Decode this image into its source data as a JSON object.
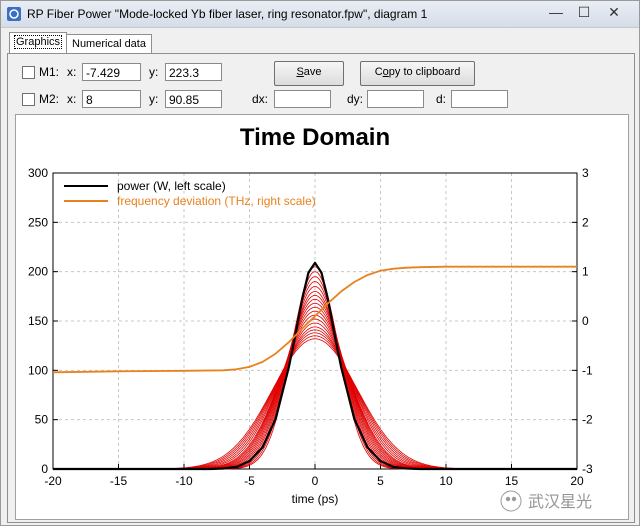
{
  "window": {
    "title": "RP Fiber Power \"Mode-locked Yb fiber laser, ring resonator.fpw\", diagram 1",
    "minimize_glyph": "—",
    "maximize_glyph": "☐",
    "close_glyph": "✕"
  },
  "tabs": [
    {
      "label": "Graphics",
      "active": true
    },
    {
      "label": "Numerical data",
      "active": false
    }
  ],
  "markers": {
    "m1": {
      "label": "M1:",
      "x_label": "x:",
      "x": "-7.429",
      "y_label": "y:",
      "y": "223.3",
      "checked": false
    },
    "m2": {
      "label": "M2:",
      "x_label": "x:",
      "x": "8",
      "y_label": "y:",
      "y": "90.85",
      "checked": false
    },
    "dx_label": "dx:",
    "dx": "",
    "dy_label": "dy:",
    "dy": "",
    "d_label": "d:",
    "d": ""
  },
  "buttons": {
    "save_hot": "S",
    "save_rest": "ave",
    "copy_pre": "C",
    "copy_hot": "o",
    "copy_rest": "py to clipboard"
  },
  "watermark": "武汉星光",
  "colors": {
    "power": "#000000",
    "power_history": "#e00000",
    "frequency": "#e8821e",
    "grid": "#c8c8c8"
  },
  "chart_data": {
    "type": "line",
    "title": "Time Domain",
    "xlabel": "time (ps)",
    "ylabel": "",
    "xlim": [
      -20,
      20
    ],
    "ylim": [
      0,
      300
    ],
    "y2lim": [
      -3,
      3
    ],
    "x_ticks": [
      -20,
      -15,
      -10,
      -5,
      0,
      5,
      10,
      15,
      20
    ],
    "x_tick_labels": [
      "-20",
      "-15",
      "-10",
      "-5",
      "0",
      "5",
      "10",
      "15",
      "20"
    ],
    "y_ticks": [
      0,
      50,
      100,
      150,
      200,
      250,
      300
    ],
    "y_tick_labels": [
      "0",
      "50",
      "100",
      "150",
      "200",
      "250",
      "300"
    ],
    "y2_ticks": [
      -3,
      -2,
      -1,
      0,
      1,
      2,
      3
    ],
    "y2_tick_labels": [
      "-3",
      "-2",
      "-1",
      "0",
      "1",
      "2",
      "3"
    ],
    "grid": true,
    "legend_position": "top-left",
    "series": [
      {
        "name": "power (W, left scale)",
        "axis": "left",
        "x": [
          -20,
          -8,
          -7,
          -6,
          -5,
          -4,
          -3,
          -2,
          -1.5,
          -1,
          -0.5,
          0,
          0.5,
          1,
          1.5,
          2,
          3,
          4,
          5,
          6,
          7,
          8,
          20
        ],
        "y": [
          0,
          0,
          0.5,
          2,
          8,
          22,
          51,
          103,
          136,
          171,
          199,
          209,
          199,
          171,
          136,
          103,
          51,
          22,
          8,
          2,
          0.5,
          0,
          0
        ]
      },
      {
        "name": "frequency deviation (THz, right scale)",
        "axis": "right",
        "x": [
          -20,
          -15,
          -10,
          -7,
          -6,
          -5,
          -4,
          -3,
          -2,
          -1,
          0,
          1,
          2,
          3,
          4,
          5,
          6,
          7,
          8,
          10,
          15,
          20
        ],
        "y": [
          -1.04,
          -1.02,
          -1.01,
          -1.0,
          -0.98,
          -0.93,
          -0.83,
          -0.66,
          -0.43,
          -0.16,
          0.1,
          0.36,
          0.6,
          0.79,
          0.93,
          1.02,
          1.06,
          1.08,
          1.09,
          1.1,
          1.1,
          1.1
        ]
      }
    ],
    "history": {
      "axis": "left",
      "peaks": [
        205,
        200,
        195,
        190,
        185,
        180,
        176,
        172,
        168,
        164,
        160,
        156,
        152,
        148,
        144,
        141,
        138,
        135,
        132
      ],
      "widths": [
        2.5,
        2.6,
        2.7,
        2.8,
        2.9,
        3.0,
        3.1,
        3.2,
        3.3,
        3.4,
        3.5,
        3.6,
        3.7,
        3.85,
        4.0,
        4.15,
        4.3,
        4.45,
        4.6
      ],
      "center": 0,
      "shape": "gaussian"
    }
  }
}
